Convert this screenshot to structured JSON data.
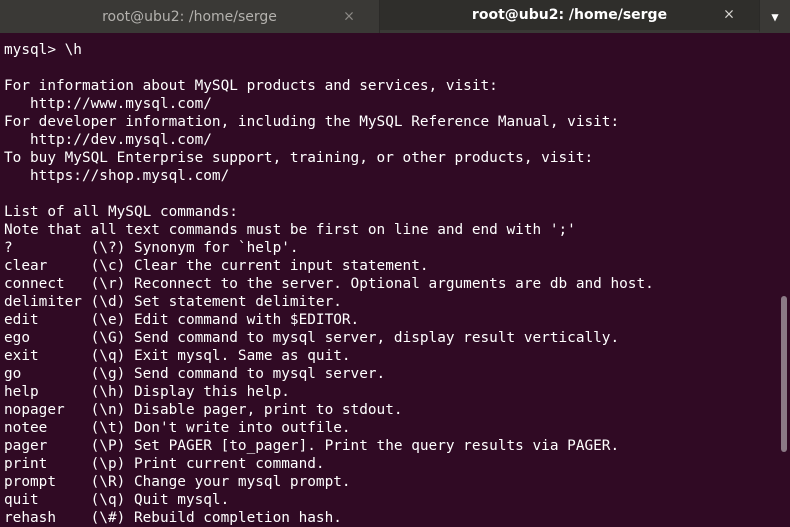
{
  "tabs": [
    {
      "title": "root@ubu2: /home/serge",
      "active": false
    },
    {
      "title": "root@ubu2: /home/serge",
      "active": true
    }
  ],
  "icons": {
    "tab_close": "×",
    "tabs_menu": "▼"
  },
  "colors": {
    "terminal_bg": "#300a24",
    "text": "#ffffff",
    "tabbar_bg": "#3a3936"
  },
  "terminal": {
    "lines": [
      "mysql> \\h",
      "",
      "For information about MySQL products and services, visit:",
      "   http://www.mysql.com/",
      "For developer information, including the MySQL Reference Manual, visit:",
      "   http://dev.mysql.com/",
      "To buy MySQL Enterprise support, training, or other products, visit:",
      "   https://shop.mysql.com/",
      "",
      "List of all MySQL commands:",
      "Note that all text commands must be first on line and end with ';'",
      "?         (\\?) Synonym for `help'.",
      "clear     (\\c) Clear the current input statement.",
      "connect   (\\r) Reconnect to the server. Optional arguments are db and host.",
      "delimiter (\\d) Set statement delimiter.",
      "edit      (\\e) Edit command with $EDITOR.",
      "ego       (\\G) Send command to mysql server, display result vertically.",
      "exit      (\\q) Exit mysql. Same as quit.",
      "go        (\\g) Send command to mysql server.",
      "help      (\\h) Display this help.",
      "nopager   (\\n) Disable pager, print to stdout.",
      "notee     (\\t) Don't write into outfile.",
      "pager     (\\P) Set PAGER [to_pager]. Print the query results via PAGER.",
      "print     (\\p) Print current command.",
      "prompt    (\\R) Change your mysql prompt.",
      "quit      (\\q) Quit mysql.",
      "rehash    (\\#) Rebuild completion hash."
    ]
  }
}
